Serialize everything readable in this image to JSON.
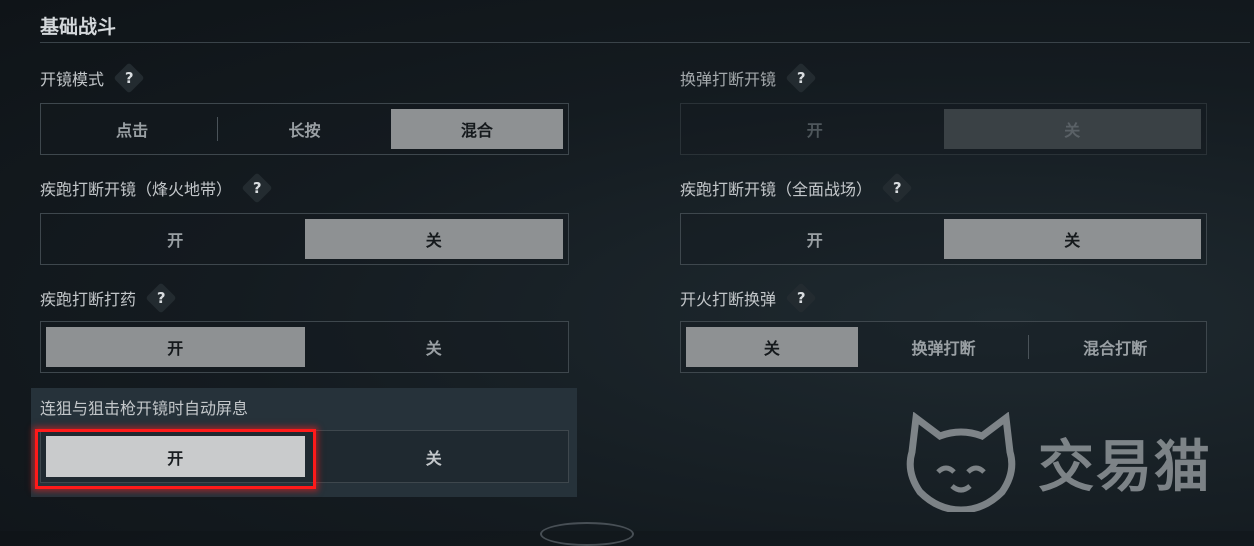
{
  "section_title": "基础战斗",
  "settings": {
    "scope_mode": {
      "label": "开镜模式",
      "options": [
        "点击",
        "长按",
        "混合"
      ],
      "selected": 2
    },
    "sprint_scope_warzone": {
      "label": "疾跑打断开镜（烽火地带）",
      "options": [
        "开",
        "关"
      ],
      "selected": 1
    },
    "sprint_medicine": {
      "label": "疾跑打断打药",
      "options": [
        "开",
        "关"
      ],
      "selected": 0
    },
    "auto_hold_breath": {
      "label": "连狙与狙击枪开镜时自动屏息",
      "options": [
        "开",
        "关"
      ],
      "selected": 0
    },
    "reload_scope": {
      "label": "换弹打断开镜",
      "options": [
        "开",
        "关"
      ],
      "selected": 1,
      "disabled": true
    },
    "sprint_scope_fullwar": {
      "label": "疾跑打断开镜（全面战场）",
      "options": [
        "开",
        "关"
      ],
      "selected": 1
    },
    "fire_reload": {
      "label": "开火打断换弹",
      "options": [
        "关",
        "换弹打断",
        "混合打断"
      ],
      "selected": 0
    }
  },
  "help_glyph": "?",
  "watermark": {
    "text": "交易猫",
    "icon": "cat-face-icon"
  },
  "colors": {
    "highlight": "#ff1a1a",
    "selected": "#8e9193",
    "background": "#141b20"
  }
}
